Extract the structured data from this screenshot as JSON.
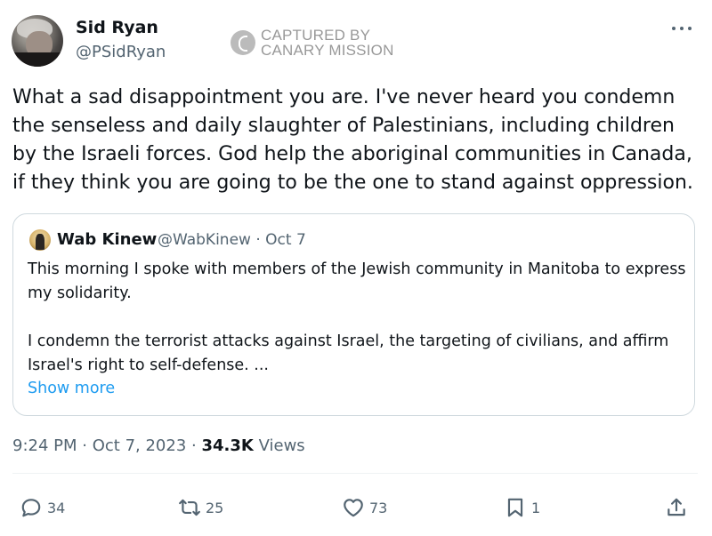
{
  "author": {
    "display_name": "Sid Ryan",
    "handle": "@PSidRyan"
  },
  "watermark": {
    "line1": "CAPTURED BY",
    "line2": "CANARY MISSION"
  },
  "tweet": {
    "text": "What a sad disappointment you are. I've never heard you condemn the senseless and daily slaughter of Palestinians, including children by the Israeli forces. God help the aboriginal communities in Canada,  if they think you are going to be the one to stand against oppression."
  },
  "quoted_tweet": {
    "display_name": "Wab Kinew",
    "meta": "@WabKinew · Oct 7",
    "paragraph1": "This morning I spoke with members of the Jewish community in Manitoba to express my solidarity.",
    "paragraph2": "I condemn the terrorist attacks against Israel, the targeting of civilians, and affirm Israel's right to self-defense. ...",
    "show_more": "Show more"
  },
  "meta": {
    "time": "9:24 PM",
    "date": "Oct 7, 2023",
    "separator": "·",
    "views_count": "34.3K",
    "views_label": "Views"
  },
  "actions": {
    "replies": "34",
    "retweets": "25",
    "likes": "73",
    "bookmarks": "1"
  },
  "icons": [
    "more-icon",
    "reply-icon",
    "retweet-icon",
    "like-icon",
    "bookmark-icon",
    "share-icon"
  ],
  "colors": {
    "text": "#0f1419",
    "muted": "#536471",
    "link": "#1d9bf0",
    "border": "#cfd9de"
  }
}
